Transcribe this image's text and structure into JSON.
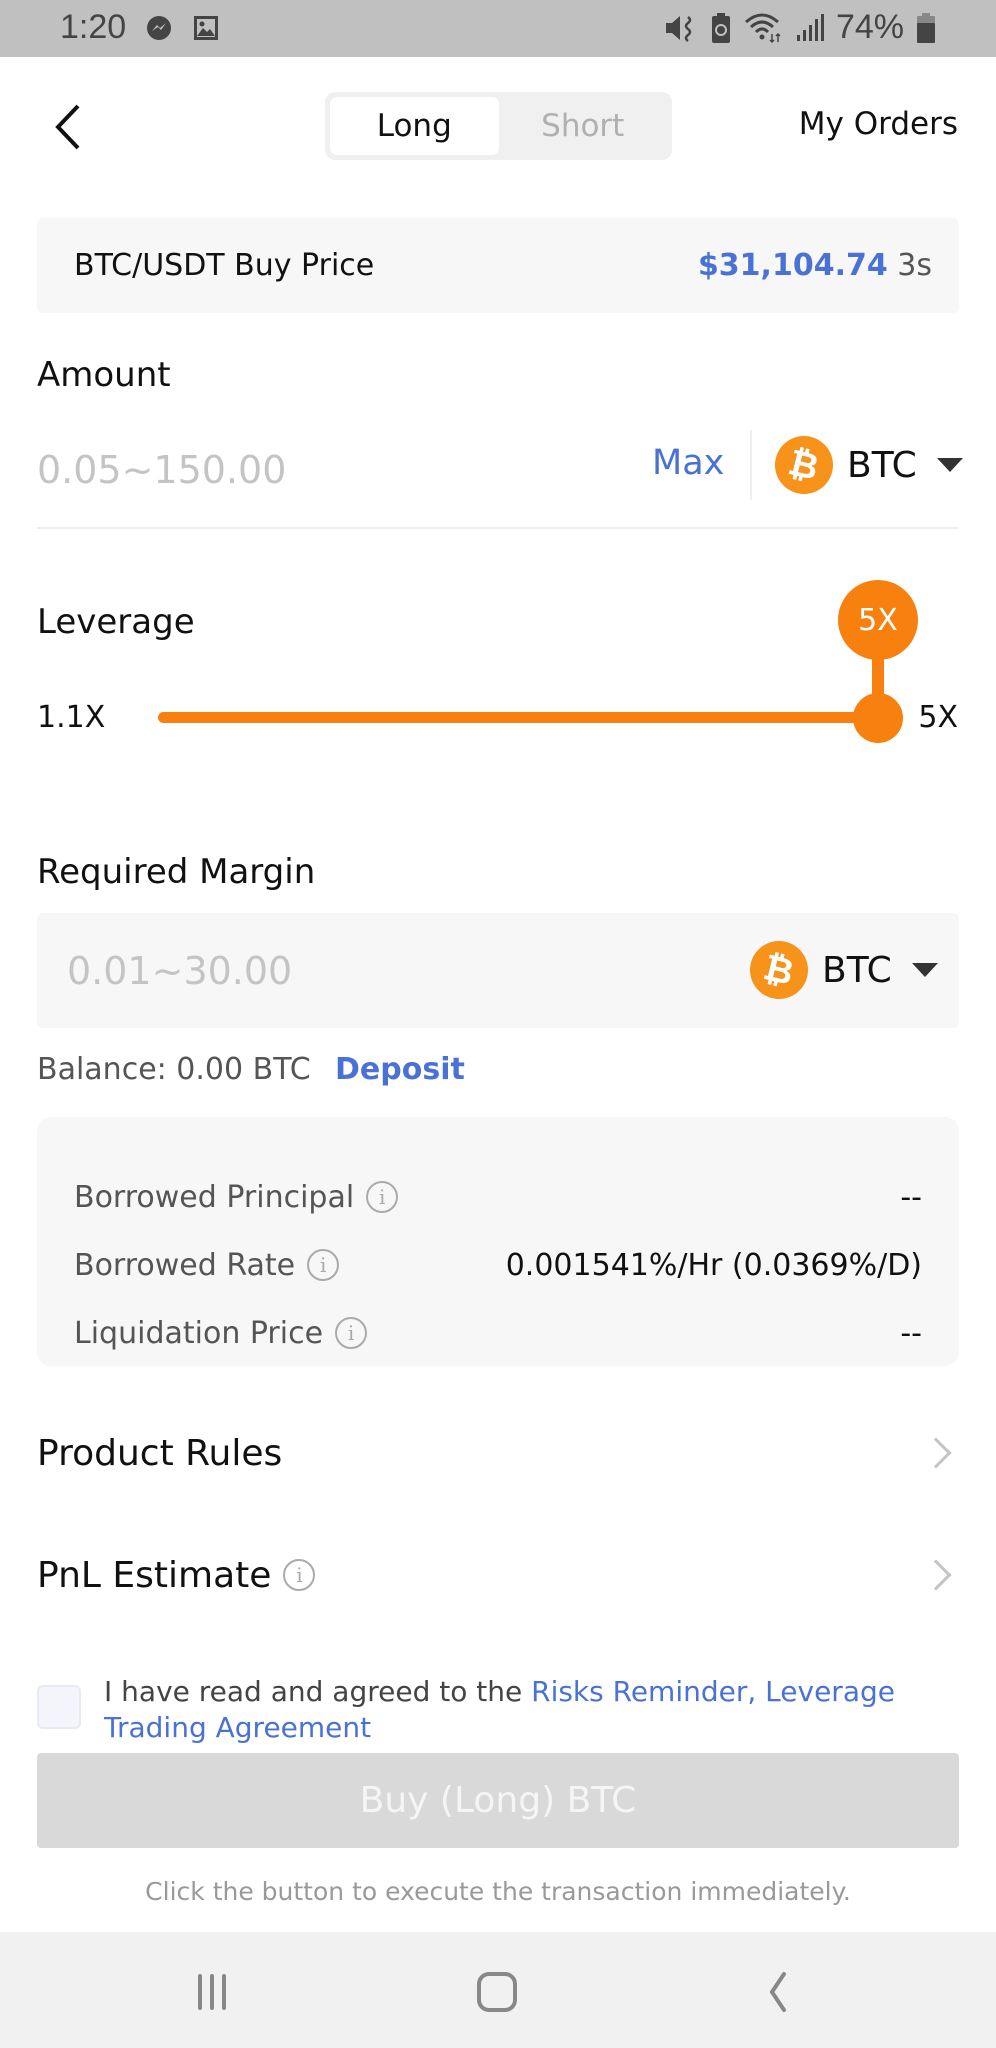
{
  "status_bar": {
    "time": "1:20",
    "battery": "74%",
    "left_icons": [
      "messenger-icon",
      "gallery-icon"
    ],
    "right_icons": [
      "mute-vibrate-icon",
      "battery-saver-icon",
      "wifi-icon",
      "signal-icon",
      "battery-icon"
    ]
  },
  "header": {
    "back_icon": "chevron-left-icon",
    "tabs": [
      {
        "label": "Long",
        "active": true
      },
      {
        "label": "Short",
        "active": false
      }
    ],
    "my_orders_label": "My Orders"
  },
  "price": {
    "label": "BTC/USDT Buy Price",
    "value": "$31,104.74",
    "age": "3s"
  },
  "amount": {
    "label": "Amount",
    "value": "",
    "placeholder": "0.05~150.00",
    "max_label": "Max",
    "currency": "BTC"
  },
  "leverage": {
    "label": "Leverage",
    "min_label": "1.1X",
    "max_label": "5X",
    "min": 1.1,
    "max": 5,
    "value": 5,
    "value_label": "5X"
  },
  "margin": {
    "label": "Required Margin",
    "value": "",
    "placeholder": "0.01~30.00",
    "currency": "BTC",
    "balance_text": "Balance: 0.00 BTC",
    "deposit_label": "Deposit"
  },
  "info": [
    {
      "label": "Borrowed Principal",
      "value": "--"
    },
    {
      "label": "Borrowed Rate",
      "value": "0.001541%/Hr (0.0369%/D)"
    },
    {
      "label": "Liquidation Price",
      "value": "--"
    }
  ],
  "links": {
    "product_rules": "Product Rules",
    "pnl_estimate": "PnL Estimate"
  },
  "agreement": {
    "checked": false,
    "text": "I have read and agreed to the ",
    "link": "Risks Reminder, Leverage Trading Agreement"
  },
  "buy_button_label": "Buy (Long) BTC",
  "helper_text": "Click the button to execute the transaction immediately.",
  "colors": {
    "accent_orange": "#f7800f",
    "btc_orange": "#f7931a",
    "link_blue": "#4a72d4",
    "disabled_button": "#d9d9d9"
  }
}
